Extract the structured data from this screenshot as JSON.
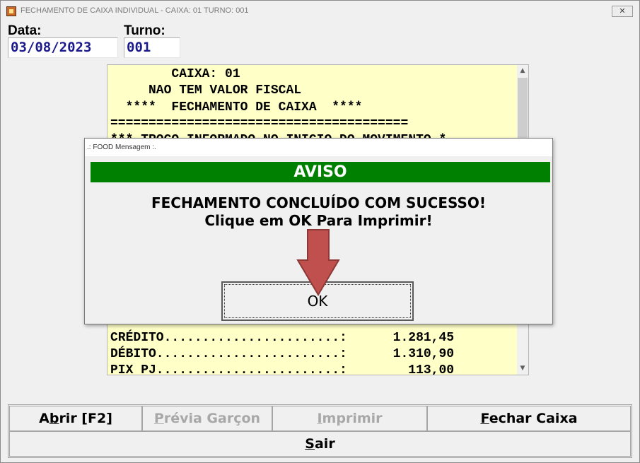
{
  "window": {
    "title": "FECHAMENTO DE CAIXA INDIVIDUAL - CAIXA: 01 TURNO: 001",
    "close_label": "✕"
  },
  "header": {
    "data_label": "Data:",
    "data_value": "03/08/2023",
    "turno_label": "Turno:",
    "turno_value": "001"
  },
  "report": {
    "lines": [
      "        CAIXA: 01",
      "     NAO TEM VALOR FISCAL",
      "  ****  FECHAMENTO DE CAIXA  ****",
      "=======================================",
      "*** TROCO INFORMADO NO INICIO DO MOVIMENTO *",
      "",
      "",
      "",
      "",
      "",
      "",
      "",
      "",
      "",
      "",
      "",
      "CRÉDITO.......................:      1.281,45",
      "DÉBITO........................:      1.310,90",
      "PIX PJ........................:        113,00"
    ]
  },
  "dialog": {
    "title": ".: FOOD Mensagem :.",
    "header": "AVISO",
    "line1": "FECHAMENTO CONCLUÍDO COM SUCESSO!",
    "line2": "Clique em OK Para Imprimir!",
    "ok_label": "OK"
  },
  "buttons": {
    "abrir": {
      "pre": "A",
      "key": "b",
      "post": "rir [F2]"
    },
    "previa": {
      "pre": "",
      "key": "P",
      "post": "révia Garçon"
    },
    "imprimir": {
      "pre": "",
      "key": "I",
      "post": "mprimir"
    },
    "fechar": {
      "pre": "",
      "key": "F",
      "post": "echar Caixa"
    },
    "sair": {
      "pre": "",
      "key": "S",
      "post": "air"
    }
  },
  "colors": {
    "aviso_green": "#008000",
    "report_bg": "#ffffc8",
    "field_text": "#1a1a8c",
    "arrow": "#c0504d"
  }
}
